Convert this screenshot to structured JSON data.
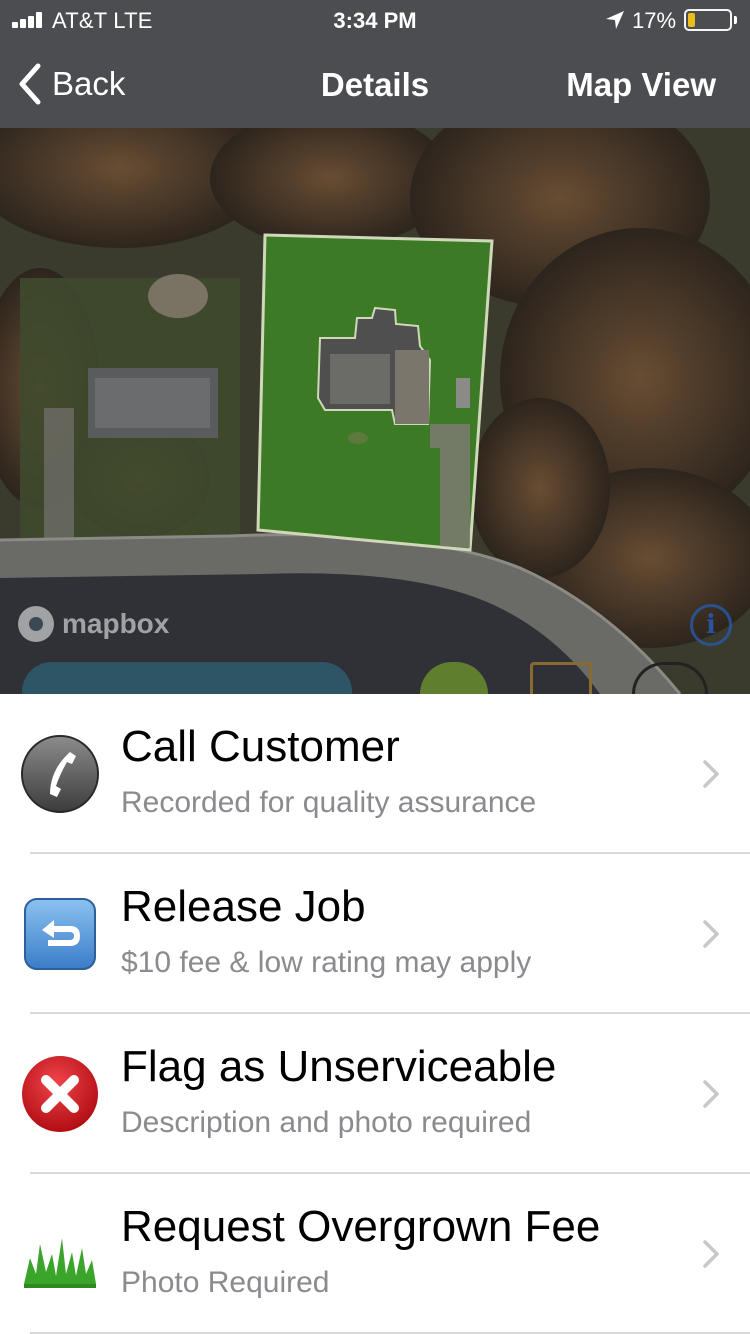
{
  "status_bar": {
    "carrier": "AT&T  LTE",
    "time": "3:34 PM",
    "battery_percent": "17%",
    "battery_level": 0.17,
    "icons": [
      "signal-bars-icon",
      "location-arrow-icon",
      "battery-icon"
    ]
  },
  "nav": {
    "back_label": "Back",
    "title": "Details",
    "right_label": "Map View"
  },
  "map": {
    "attribution": "mapbox",
    "info_glyph": "i",
    "highlight_color": "#3c7a25"
  },
  "actions": [
    {
      "title": "Call Customer",
      "subtitle": "Recorded for quality assurance",
      "icon": "phone-icon"
    },
    {
      "title": "Release Job",
      "subtitle": "$10 fee & low rating may apply",
      "icon": "return-arrow-icon"
    },
    {
      "title": "Flag as Unserviceable",
      "subtitle": "Description and photo required",
      "icon": "red-x-icon"
    },
    {
      "title": "Request Overgrown Fee",
      "subtitle": "Photo Required",
      "icon": "grass-icon"
    }
  ],
  "colors": {
    "nav_bar": "#4b4d50",
    "subtitle_text": "#8a8a8f",
    "chevron": "#c7c7cc",
    "flag_red": "#d0111b",
    "release_blue": "#4a8fd6",
    "grass_green": "#3aa52a"
  }
}
